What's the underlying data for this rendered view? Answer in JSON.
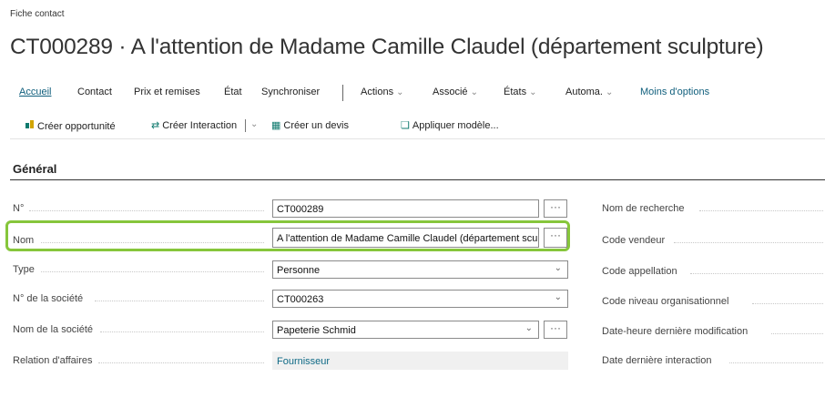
{
  "page": {
    "eyebrow": "Fiche contact",
    "title": "CT000289 · A l'attention de Madame Camille Claudel (département sculpture)"
  },
  "nav": {
    "items": [
      "Accueil",
      "Contact",
      "Prix et remises",
      "État",
      "Synchroniser",
      "Actions",
      "Associé",
      "États",
      "Automa.",
      "Moins d'options"
    ],
    "active": "Accueil"
  },
  "commands": [
    {
      "label": "Créer opportunité",
      "icon": "opportunity-icon"
    },
    {
      "label": "Créer Interaction",
      "icon": "interaction-icon"
    },
    {
      "label": "Créer un devis",
      "icon": "quote-icon"
    },
    {
      "label": "Appliquer modèle...",
      "icon": "template-icon"
    }
  ],
  "section_title": "Général",
  "fields_left": [
    {
      "label": "N°",
      "value": "CT000289",
      "control": "text+more"
    },
    {
      "label": "Nom",
      "value": "A l'attention de Madame Camille Claudel (département sculpture)",
      "control": "text+more"
    },
    {
      "label": "Type",
      "value": "Personne",
      "control": "dropdown"
    },
    {
      "label": "N° de la société",
      "value": "CT000263",
      "control": "dropdown"
    },
    {
      "label": "Nom de la société",
      "value": "Papeterie Schmid",
      "control": "dropdown+more"
    },
    {
      "label": "Relation d'affaires",
      "value": "Fournisseur",
      "control": "readonly"
    }
  ],
  "fields_right": [
    {
      "label": "Nom de recherche"
    },
    {
      "label": "Code vendeur"
    },
    {
      "label": "Code appellation"
    },
    {
      "label": "Code niveau organisationnel"
    },
    {
      "label": "Date-heure dernière modification"
    },
    {
      "label": "Date dernière interaction"
    }
  ],
  "symbols": {
    "more": "···",
    "chevron": "⌄"
  },
  "colors": {
    "accent": "#0f5e7c",
    "highlight": "#86c63b",
    "link": "#0f6a86"
  }
}
